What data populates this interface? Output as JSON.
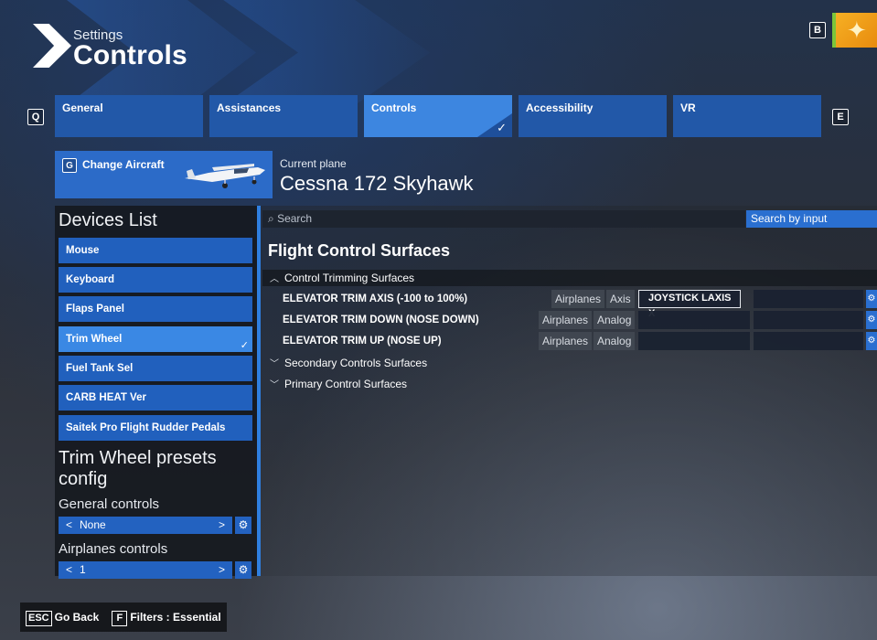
{
  "header": {
    "section_label": "Settings",
    "page_title": "Controls",
    "back_key": "B"
  },
  "tabs": {
    "prev_key": "Q",
    "next_key": "E",
    "items": [
      {
        "label": "General"
      },
      {
        "label": "Assistances"
      },
      {
        "label": "Controls",
        "active": true
      },
      {
        "label": "Accessibility"
      },
      {
        "label": "VR"
      }
    ]
  },
  "aircraft": {
    "change_key": "G",
    "change_label": "Change Aircraft",
    "current_label": "Current plane",
    "current_name": "Cessna 172 Skyhawk"
  },
  "devices": {
    "title": "Devices List",
    "items": [
      {
        "label": "Mouse"
      },
      {
        "label": "Keyboard"
      },
      {
        "label": "Flaps Panel"
      },
      {
        "label": "Trim Wheel",
        "active": true
      },
      {
        "label": "Fuel Tank Sel"
      },
      {
        "label": "CARB HEAT Ver"
      },
      {
        "label": "Saitek Pro Flight Rudder Pedals"
      }
    ]
  },
  "presets": {
    "title": "Trim Wheel presets config",
    "general_label": "General controls",
    "general_value": "None",
    "airplanes_label": "Airplanes controls",
    "airplanes_value": "1"
  },
  "search": {
    "placeholder": "Search",
    "by_input_label": "Search by input"
  },
  "bindings": {
    "section_title": "Flight Control Surfaces",
    "groups": [
      {
        "label": "Control Trimming Surfaces",
        "expanded": true,
        "rows": [
          {
            "name": "ELEVATOR TRIM AXIS (-100 to 100%)",
            "category": "Airplanes",
            "type": "Axis",
            "input1": "JOYSTICK LAXIS X",
            "input2": ""
          },
          {
            "name": "ELEVATOR TRIM DOWN (NOSE DOWN)",
            "category": "Airplanes",
            "type": "Analog",
            "input1": "",
            "input2": ""
          },
          {
            "name": "ELEVATOR TRIM UP (NOSE UP)",
            "category": "Airplanes",
            "type": "Analog",
            "input1": "",
            "input2": ""
          }
        ]
      },
      {
        "label": "Secondary Controls Surfaces",
        "expanded": false
      },
      {
        "label": "Primary Control Surfaces",
        "expanded": false
      }
    ]
  },
  "footer": {
    "back_key": "ESC",
    "back_label": "Go Back",
    "filter_key": "F",
    "filter_label": "Filters : Essential"
  },
  "colors": {
    "accent": "#2c6bc8",
    "active": "#3d86e0",
    "panel": "#14181e"
  }
}
